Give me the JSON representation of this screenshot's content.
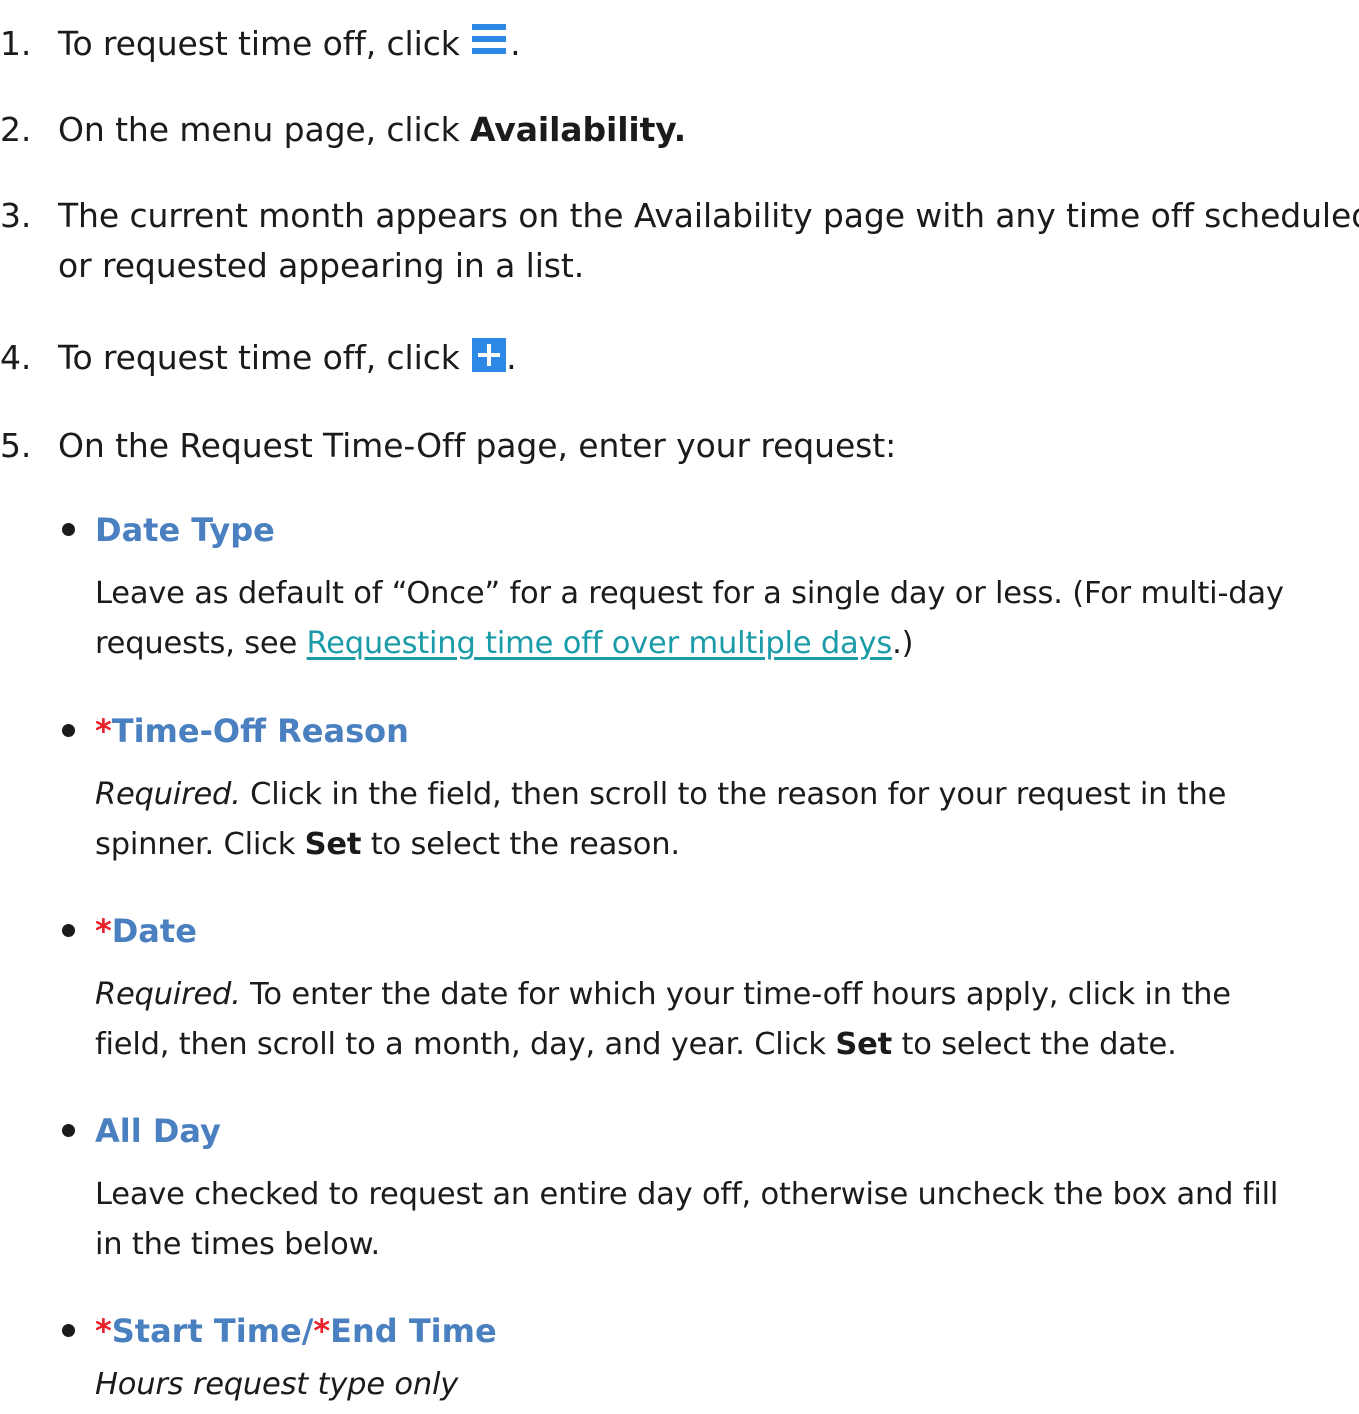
{
  "steps": [
    {
      "num": "1.",
      "text_before": "To request time off, click ",
      "icon": "menu-icon",
      "text_after": "."
    },
    {
      "num": "2.",
      "text_before": "On the menu page, click ",
      "bold": "Availability."
    },
    {
      "num": "3.",
      "line1": "The current month appears on the Availability page with any time off scheduled",
      "line2": "or requested appearing in a list."
    },
    {
      "num": "4.",
      "text_before": "To request time off, click ",
      "icon": "plus-icon",
      "text_after": "."
    },
    {
      "num": "5.",
      "text": "On the Request Time-Off page, enter your request:"
    }
  ],
  "fields": {
    "date_type": {
      "title": "Date Type",
      "line1": "Leave as default of “Once” for a request for a single day or less. (For multi-day",
      "line2_before": "requests, see ",
      "link": "Requesting time off over multiple days",
      "line2_after": ".)"
    },
    "time_off_reason": {
      "asterisk": "*",
      "title": "Time-Off Reason",
      "req_label": "Required.",
      "line1_rest": " Click in the field, then scroll to the reason for your request in the",
      "line2_before": "spinner. Click ",
      "bold": "Set",
      "line2_after": " to select the reason."
    },
    "date": {
      "asterisk": "*",
      "title": "Date",
      "req_label": "Required.",
      "line1_rest": " To enter the date for which your time-off hours apply, click in the",
      "line2_before": "field, then scroll to a month, day, and year. Click ",
      "bold": "Set",
      "line2_after": " to select the date."
    },
    "all_day": {
      "title": "All Day",
      "line1": "Leave checked to request an entire day off, otherwise uncheck the box and fill",
      "line2": "in the times below."
    },
    "start_end_time": {
      "asterisk1": "*",
      "title1": "Start Time/",
      "asterisk2": "*",
      "title2": "End Time",
      "note": "Hours request type only"
    }
  },
  "colors": {
    "icon_blue": "#2d88e6",
    "heading_blue": "#4a7fc0",
    "required_red": "#e8212b",
    "link_teal": "#1b9ba8"
  }
}
